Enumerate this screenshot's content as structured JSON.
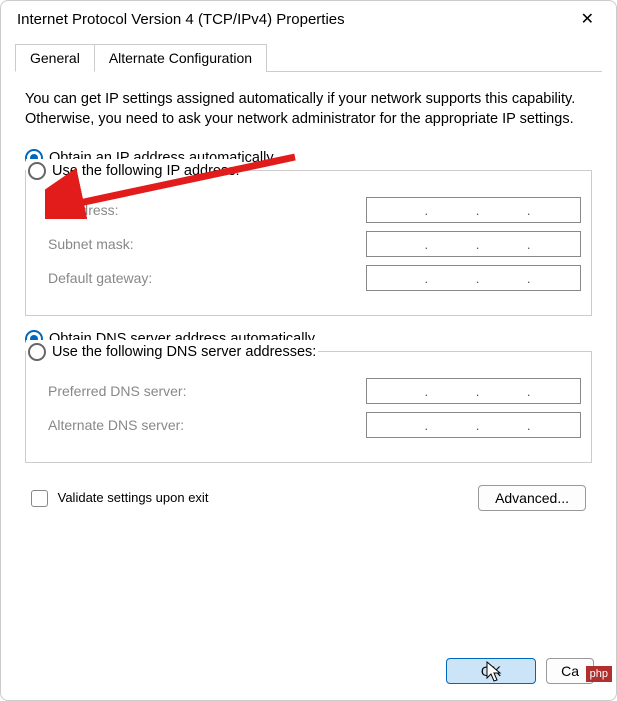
{
  "window": {
    "title": "Internet Protocol Version 4 (TCP/IPv4) Properties"
  },
  "tabs": {
    "general": "General",
    "alternate": "Alternate Configuration"
  },
  "description": "You can get IP settings assigned automatically if your network supports this capability. Otherwise, you need to ask your network administrator for the appropriate IP settings.",
  "ip_section": {
    "obtain_auto": "Obtain an IP address automatically",
    "use_following": "Use the following IP address:",
    "ip_address_label": "IP address:",
    "subnet_label": "Subnet mask:",
    "gateway_label": "Default gateway:"
  },
  "dns_section": {
    "obtain_auto": "Obtain DNS server address automatically",
    "use_following": "Use the following DNS server addresses:",
    "preferred_label": "Preferred DNS server:",
    "alternate_label": "Alternate DNS server:"
  },
  "validate_label": "Validate settings upon exit",
  "buttons": {
    "advanced": "Advanced...",
    "ok": "OK",
    "cancel": "Cancel"
  },
  "watermark": "php"
}
